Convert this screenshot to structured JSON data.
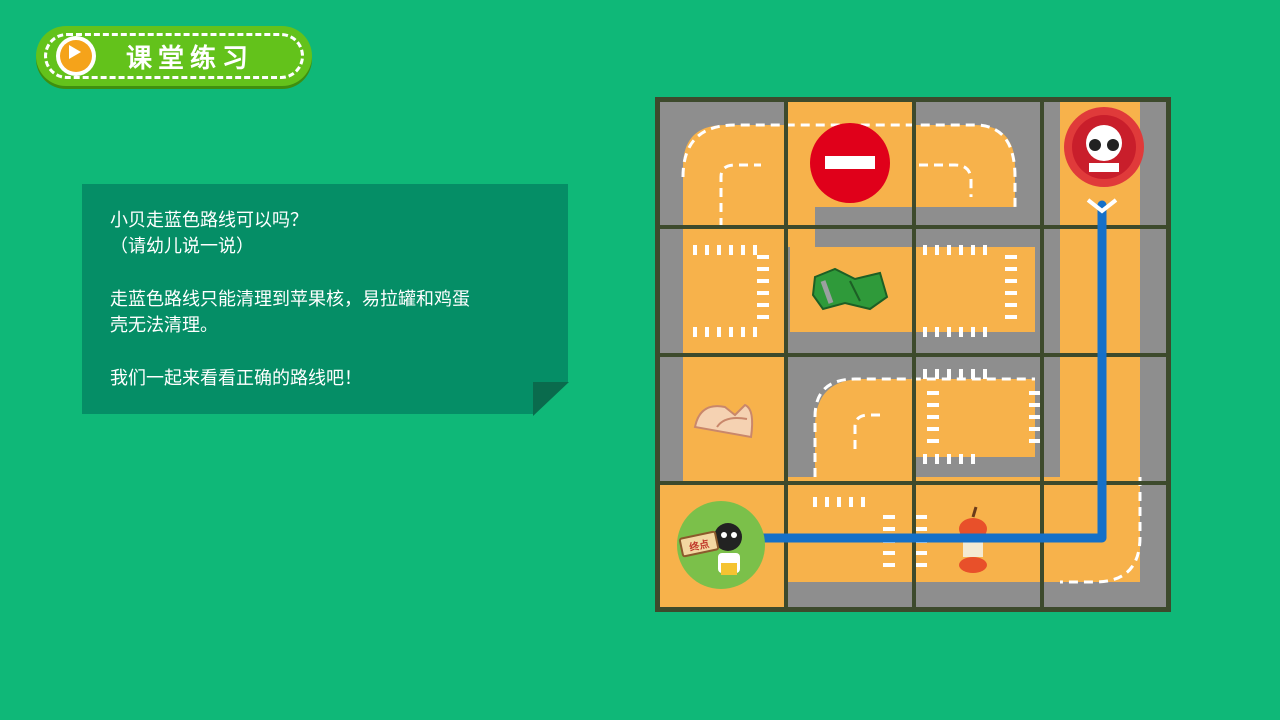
{
  "header": {
    "title": "课堂练习"
  },
  "note": {
    "line1": "小贝走蓝色路线可以吗？",
    "line2": "（请幼儿说一说）",
    "line3": "走蓝色路线只能清理到苹果核，易拉罐和鸡蛋",
    "line4": "壳无法清理。",
    "line5": "我们一起来看看正确的路线吧！"
  },
  "board": {
    "finish_sign": "终点",
    "route_color": "#1570c8",
    "items": [
      "no-entry-sign",
      "crushed-can",
      "egg-shell",
      "apple-core",
      "robot-character",
      "goal-badge"
    ]
  }
}
